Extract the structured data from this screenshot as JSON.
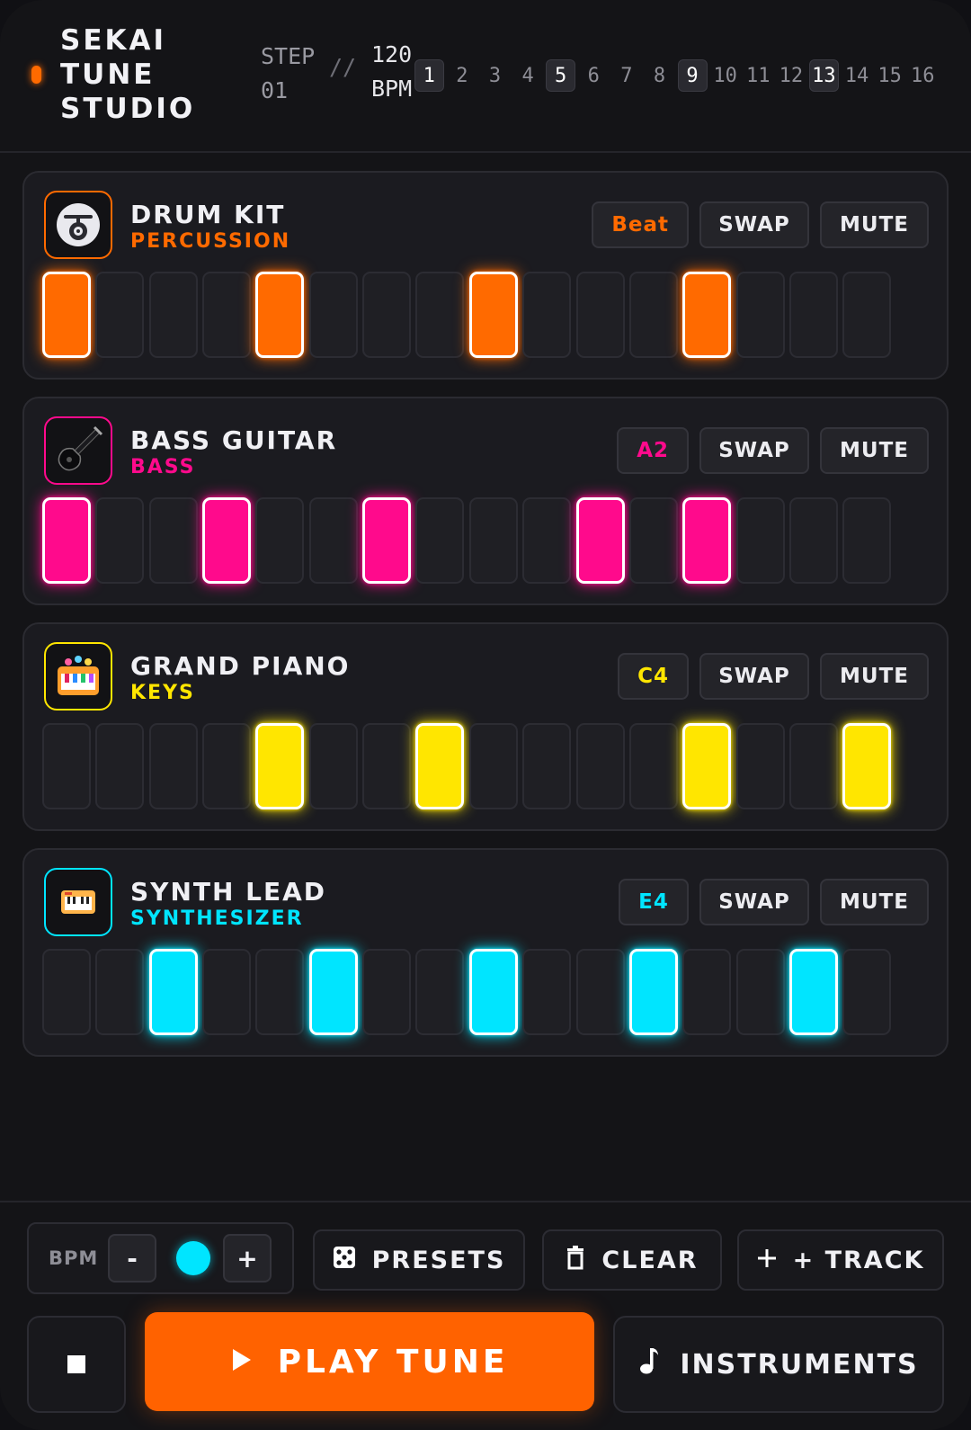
{
  "app": {
    "brand_lines": [
      "SEKAI",
      "TUNE",
      "STUDIO"
    ],
    "step_label": "STEP",
    "step_value": "01",
    "separator": "//",
    "bpm_value": "120",
    "bpm_unit": "BPM"
  },
  "step_indicator": {
    "numbers": [
      "1",
      "2",
      "3",
      "4",
      "5",
      "6",
      "7",
      "8",
      "9",
      "10",
      "11",
      "12",
      "13",
      "14",
      "15",
      "16"
    ],
    "beat_steps": [
      1,
      5,
      9,
      13
    ]
  },
  "colors": {
    "drum": "#ff6a00",
    "bass": "#ff0a8c",
    "piano": "#ffe600",
    "synth": "#00e5ff"
  },
  "tracks": [
    {
      "name": "DRUM KIT",
      "category": "PERCUSSION",
      "icon": "drum-icon",
      "color": "#ff6a00",
      "note": "Beat",
      "swap_label": "SWAP",
      "mute_label": "MUTE",
      "active_steps": [
        1,
        5,
        9,
        13
      ]
    },
    {
      "name": "BASS GUITAR",
      "category": "BASS",
      "icon": "guitar-icon",
      "color": "#ff0a8c",
      "note": "A2",
      "swap_label": "SWAP",
      "mute_label": "MUTE",
      "active_steps": [
        1,
        4,
        7,
        11,
        13
      ]
    },
    {
      "name": "GRAND PIANO",
      "category": "KEYS",
      "icon": "piano-icon",
      "color": "#ffe600",
      "note": "C4",
      "swap_label": "SWAP",
      "mute_label": "MUTE",
      "active_steps": [
        5,
        8,
        13,
        16
      ]
    },
    {
      "name": "SYNTH LEAD",
      "category": "SYNTHESIZER",
      "icon": "synth-keyboard-icon",
      "color": "#00e5ff",
      "note": "E4",
      "swap_label": "SWAP",
      "mute_label": "MUTE",
      "active_steps": [
        3,
        6,
        9,
        12,
        15
      ]
    }
  ],
  "controls": {
    "bpm_label": "BPM",
    "decrement": "-",
    "increment": "+",
    "presets": "PRESETS",
    "clear": "CLEAR",
    "add_track": "+ TRACK",
    "play": "PLAY TUNE",
    "instruments": "INSTRUMENTS"
  }
}
